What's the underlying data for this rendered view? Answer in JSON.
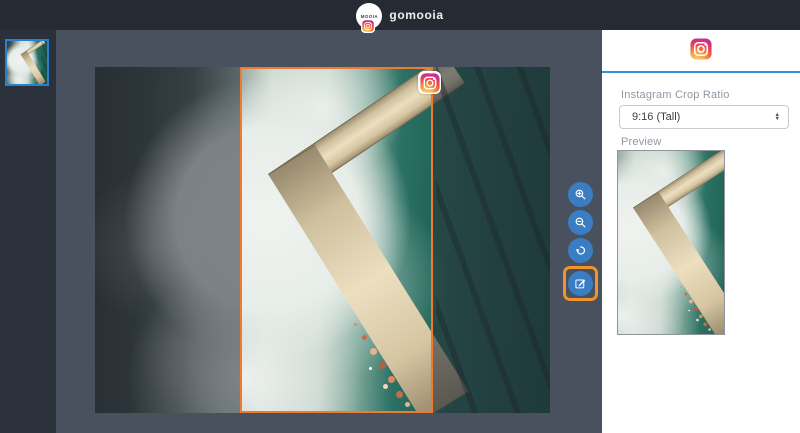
{
  "header": {
    "brand": "gomooia",
    "logo_text": "MOOIA"
  },
  "panel": {
    "crop_ratio_label": "Instagram Crop Ratio",
    "crop_ratio_value": "9:16 (Tall)",
    "preview_label": "Preview"
  },
  "icons": {
    "header_badge": "instagram-icon",
    "crop_badge": "instagram-icon",
    "panel_icon": "instagram-icon",
    "zoom_in": "zoom-in-icon",
    "zoom_out": "zoom-out-icon",
    "rotate": "rotate-ccw-icon",
    "edit": "edit-pencil-icon",
    "stepper_up": "▲",
    "stepper_down": "▼"
  },
  "colors": {
    "header_bg": "#262b33",
    "sidebar_bg": "#2b313b",
    "canvas_bg": "#48515d",
    "panel_bg": "#ffffff",
    "accent_orange": "#ee7b2f",
    "highlight_orange": "#f0932d",
    "accent_blue": "#2b93d8",
    "thumbnail_border_blue": "#2a80d0",
    "tool_button_blue": "#3a7dc2"
  }
}
